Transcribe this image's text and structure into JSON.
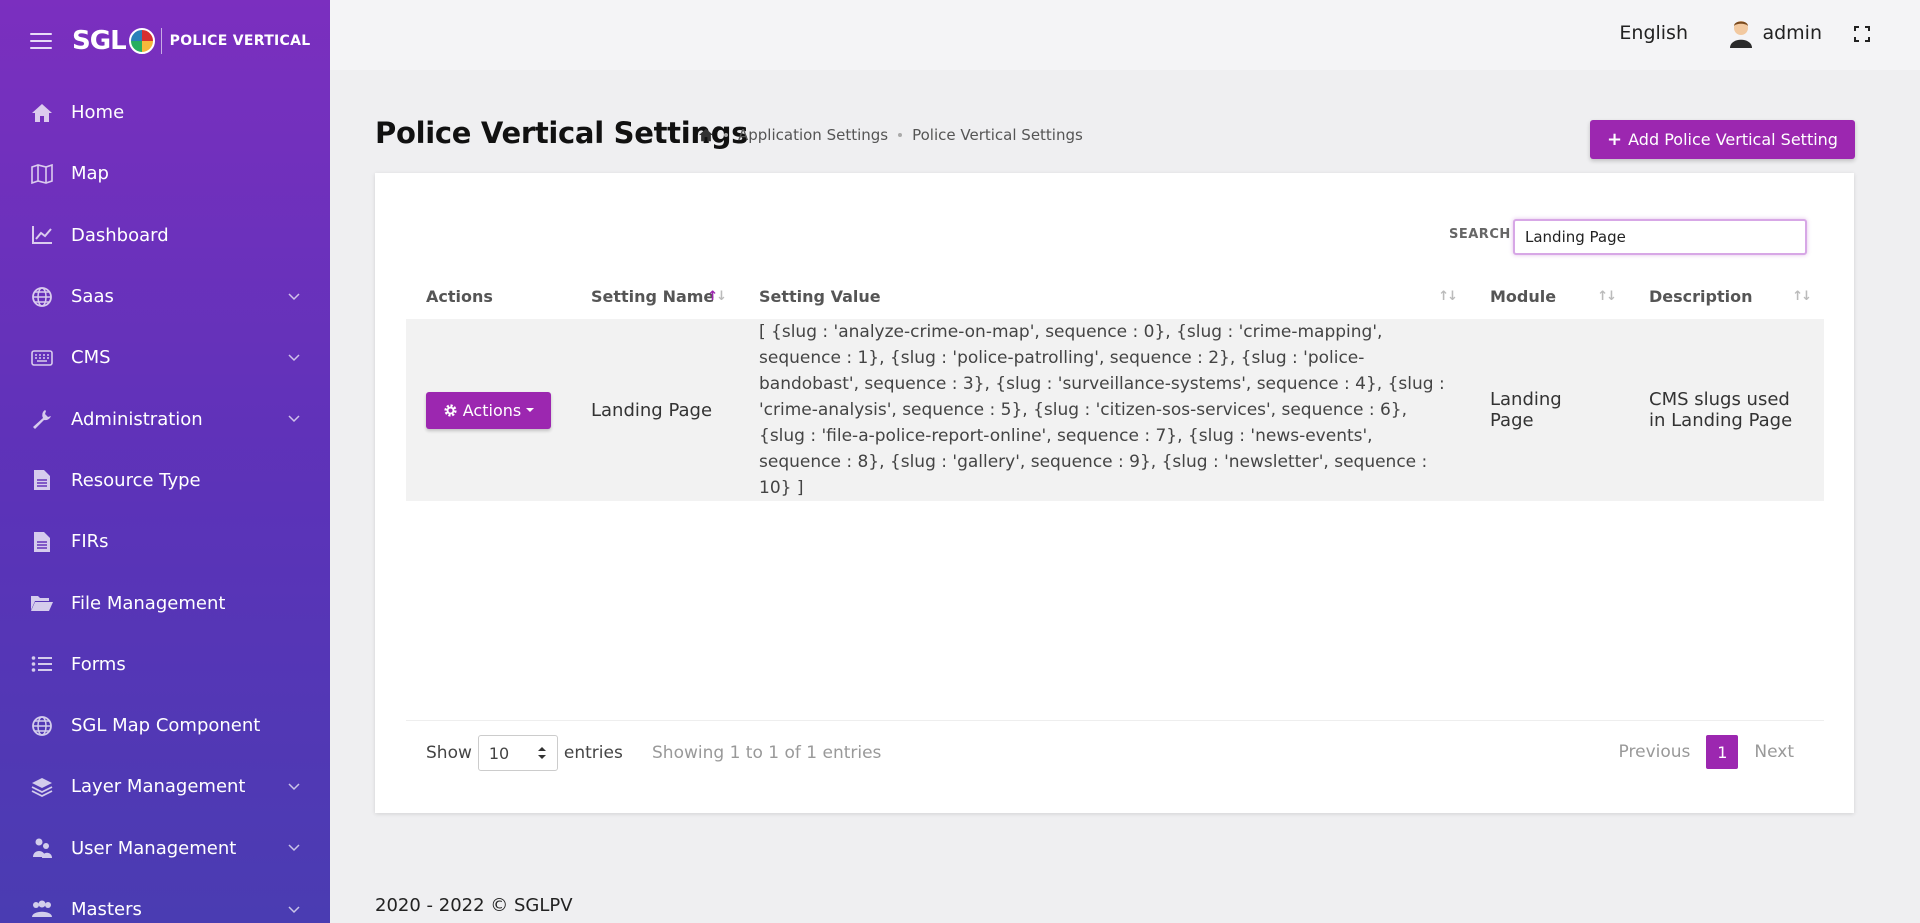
{
  "brand": {
    "logo": "SGL",
    "subtitle": "POLICE VERTICAL"
  },
  "sidebar": {
    "items": [
      {
        "label": "Home",
        "icon": "home-icon",
        "has_children": false
      },
      {
        "label": "Map",
        "icon": "map-icon",
        "has_children": false
      },
      {
        "label": "Dashboard",
        "icon": "chart-icon",
        "has_children": false
      },
      {
        "label": "Saas",
        "icon": "globe-icon",
        "has_children": true
      },
      {
        "label": "CMS",
        "icon": "keyboard-icon",
        "has_children": true
      },
      {
        "label": "Administration",
        "icon": "wrench-icon",
        "has_children": true
      },
      {
        "label": "Resource Type",
        "icon": "document-icon",
        "has_children": false
      },
      {
        "label": "FIRs",
        "icon": "document-icon",
        "has_children": false
      },
      {
        "label": "File Management",
        "icon": "folder-icon",
        "has_children": false
      },
      {
        "label": "Forms",
        "icon": "list-icon",
        "has_children": false
      },
      {
        "label": "SGL Map Component",
        "icon": "globe-icon",
        "has_children": false
      },
      {
        "label": "Layer Management",
        "icon": "layers-icon",
        "has_children": true
      },
      {
        "label": "User Management",
        "icon": "users-icon",
        "has_children": true
      },
      {
        "label": "Masters",
        "icon": "users-icon",
        "has_children": true
      }
    ]
  },
  "topbar": {
    "language": "English",
    "username": "admin"
  },
  "header": {
    "title": "Police Vertical Settings",
    "breadcrumb": [
      "Application Settings",
      "Police Vertical Settings"
    ],
    "add_button": "Add Police Vertical Setting"
  },
  "search": {
    "label": "SEARCH",
    "value": "Landing Page"
  },
  "table": {
    "columns": [
      "Actions",
      "Setting Name",
      "Setting Value",
      "Module",
      "Description"
    ],
    "rows": [
      {
        "action_label": "Actions",
        "setting_name": "Landing Page",
        "setting_value": "[ {slug : 'analyze-crime-on-map', sequence : 0}, {slug : 'crime-mapping', sequence : 1}, {slug : 'police-patrolling', sequence : 2}, {slug : 'police-bandobast', sequence : 3}, {slug : 'surveillance-systems', sequence : 4}, {slug : 'crime-analysis', sequence : 5}, {slug : 'citizen-sos-services', sequence : 6}, {slug : 'file-a-police-report-online', sequence : 7}, {slug : 'news-events', sequence : 8}, {slug : 'gallery', sequence : 9}, {slug : 'newsletter', sequence : 10} ]",
        "module": "Landing Page",
        "description": "CMS slugs used in Landing Page"
      }
    ]
  },
  "footer_controls": {
    "show_label": "Show",
    "page_length": "10",
    "entries_label": "entries",
    "info": "Showing 1 to 1 of 1 entries",
    "previous": "Previous",
    "current_page": "1",
    "next": "Next"
  },
  "copyright": "2020 - 2022 © SGLPV",
  "colors": {
    "accent": "#9c27b0",
    "sidebar_top": "#7b2fbf",
    "sidebar_bottom": "#4a3cb2"
  }
}
